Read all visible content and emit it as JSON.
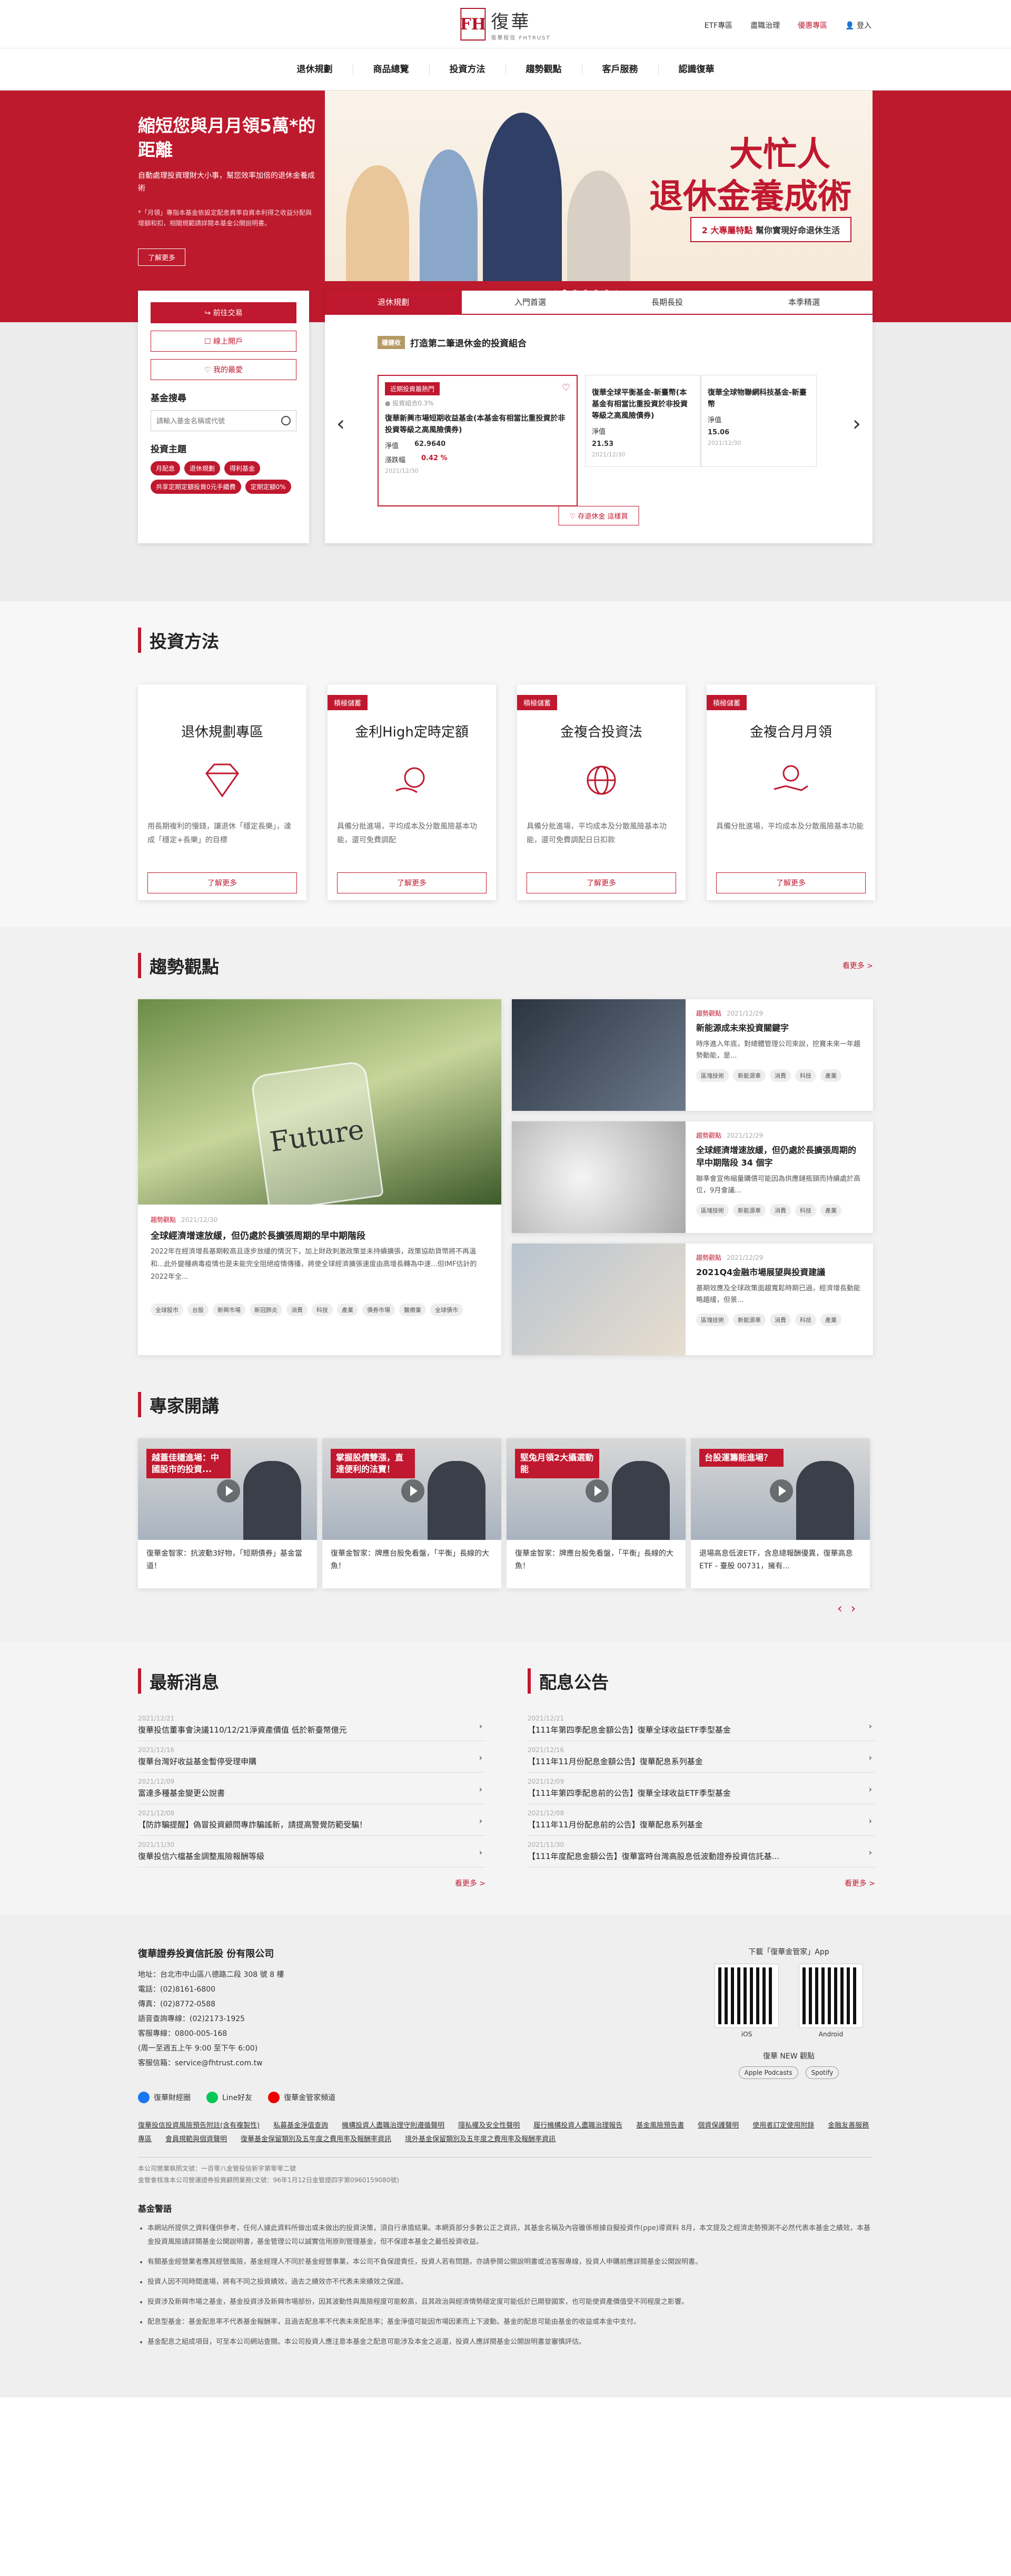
{
  "header": {
    "brand_cn": "復華",
    "brand_sub": "復華投信 FHTRUST",
    "links": [
      "ETF專區",
      "盡職治理",
      "優惠專區",
      "登入"
    ]
  },
  "nav": [
    "退休規劃",
    "商品總覽",
    "投資方法",
    "趨勢觀點",
    "客戶服務",
    "認識復華"
  ],
  "hero": {
    "title": "縮短您與月月領5萬*的距離",
    "desc": "自動處理投資理財大小事，幫您效率加倍的退休金養成術",
    "note": "*「月領」專指本基金依設定配息資率自資本利得之收益分配與增額和扣，相關規範請詳閱本基金公開說明書。",
    "button": "了解更多",
    "banner_l1": "大忙人",
    "banner_l2": "退休金養成術",
    "banner_tag_num": "2 大專屬特點",
    "banner_tag_text": " 幫你實現好命退休生活"
  },
  "side": {
    "buttons": [
      "前往交易",
      "線上開戶",
      "我的最愛"
    ],
    "search_title": "基金搜尋",
    "search_placeholder": "請輸入基金名稱或代號",
    "theme_title": "投資主題",
    "themes": [
      "月配息",
      "退休規劃",
      "得利基金",
      "共享定期定額投資0元手續費",
      "定期定額0%"
    ]
  },
  "fund": {
    "tabs": [
      "退休規劃",
      "入門首選",
      "長期長投",
      "本季精選"
    ],
    "badge": "穩健收",
    "headline": "打造第二筆退休金的投資組合",
    "main_card": {
      "hot": "近期投資最熱門",
      "meta": "● 投資組合0.3%",
      "name": "復華新興市場短期收益基金(本基金有相當比重投資於非投資等級之高風險債券)",
      "nav_label": "淨值",
      "nav_val": "62.9640",
      "chg_label": "漲跌幅",
      "chg_val": "0.42 %",
      "date": "2021/12/30"
    },
    "cards": [
      {
        "name": "復華全球平衡基金-新臺幣(本基金有相當比重投資於非投資等級之高風險債券)",
        "nav_label": "淨值",
        "nav_val": "21.53",
        "date": "2021/12/30"
      },
      {
        "name": "復華全球物聯網科技基金-新臺幣",
        "nav_label": "淨值",
        "nav_val": "15.06",
        "date": "2021/12/30"
      }
    ],
    "more": "♡ 存退休金 這樣買"
  },
  "strategy": {
    "title": "投資方法",
    "cards": [
      {
        "ribbon": "",
        "title": "退休規劃專區",
        "text": "用長期複利的慢錢，讓退休「穩定長樂」，達成「穩定+長樂」的目標",
        "btn": "了解更多"
      },
      {
        "ribbon": "積極儲蓄",
        "title": "金利High定時定額",
        "text": "具備分批進場，平均成本及分散風險基本功能，還可免費調配",
        "btn": "了解更多"
      },
      {
        "ribbon": "積極儲蓄",
        "title": "金複合投資法",
        "text": "具備分批進場，平均成本及分散風險基本功能，還可免費調配日日扣款",
        "btn": "了解更多"
      },
      {
        "ribbon": "積極儲蓄",
        "title": "金複合月月領",
        "text": "具備分批進場，平均成本及分散風險基本功能",
        "btn": "了解更多"
      }
    ]
  },
  "trend": {
    "title": "趨勢觀點",
    "more": "看更多 >",
    "big": {
      "jar": "Future",
      "cat": "趨勢觀點",
      "date": "2021/12/30",
      "title": "全球經濟增速放緩，但仍處於長擴張周期的早中期階段",
      "text": "2022年在經濟增長基期較高且逐步放緩的情況下，加上財政刺激政策並未持續擴張，政策協助貨幣將不再溫和...此外變種病毒疫情也是未能完全阻絕疫情傳播，將使全球經濟擴張速度由高增長轉為中速...但IMF估計的2022年全...",
      "chips": [
        "全球股市",
        "台股",
        "新興市場",
        "新冠肺炎",
        "消費",
        "科技",
        "產業",
        "債券市場",
        "醫療業",
        "全球債市"
      ]
    },
    "items": [
      {
        "cat": "趨勢觀點",
        "date": "2021/12/29",
        "title": "新能源成未來投資關鍵字",
        "text": "時序進入年底，對總體管理公司來說，挖寶未來一年趨勢動能，是...",
        "chips": [
          "區塊技術",
          "新能源車",
          "消費",
          "科技",
          "產業"
        ]
      },
      {
        "cat": "趨勢觀點",
        "date": "2021/12/29",
        "title": "全球經濟增速放緩，但仍處於長擴張周期的早中期階段 34 個字",
        "text": "聯準會宣佈縮量購債可能因為供應鏈瓶頸而持續處於高位，9月會議...",
        "chips": [
          "區塊技術",
          "新能源車",
          "消費",
          "科技",
          "產業"
        ]
      },
      {
        "cat": "趨勢觀點",
        "date": "2021/12/29",
        "title": "2021Q4金融市場展望與投資建議",
        "text": "基期效應及全球政策面趨寬鬆時期已過，經濟增長動能略趨緩，但景...",
        "chips": [
          "區塊技術",
          "新能源車",
          "消費",
          "科技",
          "產業"
        ]
      }
    ]
  },
  "experts": {
    "title": "專家開講",
    "videos": [
      {
        "cap": "越蓋佳穩進場：中國股市的投資...",
        "text": "復華金智家：抗波動3好物，「短期債券」基金當道！"
      },
      {
        "cap": "掌握股債雙漲，直達便利的法寶！",
        "text": "復華金智家：牌應台股免看盤，「平衡」長線的大魚！"
      },
      {
        "cap": "堅兔月領2大攝選動能",
        "text": "復華金智家：牌應台股免看盤，「平衡」長線的大魚！"
      },
      {
        "cap": "台股運籌能進場？",
        "text": "退場高息低波ETF，含息總報酬優異，復華高息ETF - 臺股 00731，擁有..."
      }
    ]
  },
  "news": {
    "title": "最新消息",
    "more": "看更多 >",
    "items": [
      {
        "d": "2021/12/21",
        "t": "復華投信董事會決議110/12/21淨資產價值 低於新臺幣億元"
      },
      {
        "d": "2021/12/16",
        "t": "復華台灣好收益基金暫停受理申購"
      },
      {
        "d": "2021/12/09",
        "t": "富達多種基金變更公說書"
      },
      {
        "d": "2021/12/08",
        "t": "【防詐騙提醒】偽冒投資顧問專詐騙謠新，請提高警覺防範受騙！"
      },
      {
        "d": "2021/11/30",
        "t": "復華投信六檔基金調整風險報酬等級"
      }
    ]
  },
  "notice": {
    "title": "配息公告",
    "more": "看更多 >",
    "items": [
      {
        "d": "2021/12/21",
        "t": "【111年第四季配息金額公告】復華全球收益ETF季型基金"
      },
      {
        "d": "2021/12/16",
        "t": "【111年11月份配息金額公告】復華配息系列基金"
      },
      {
        "d": "2021/12/09",
        "t": "【111年第四季配息前的公告】復華全球收益ETF季型基金"
      },
      {
        "d": "2021/12/08",
        "t": "【111年11月份配息前的公告】復華配息系列基金"
      },
      {
        "d": "2021/11/30",
        "t": "【111年度配息金額公告】復華富時台灣高股息低波動證券投資信託基..."
      }
    ]
  },
  "footer": {
    "company": "復華證券投資信託股 份有限公司",
    "info": [
      "地址：台北市中山區八德路二段 308 號 8 樓",
      "電話：(02)8161-6800",
      "傳真：(02)8772-0588",
      "語音查詢專線：(02)2173-1925",
      "客服專線：0800-005-168",
      "(周一至週五上午 9:00 至下午 6:00)",
      "客服信箱：service@fhtrust.com.tw"
    ],
    "app_title": "下載「復華金管家」App",
    "ios": "iOS",
    "android": "Android",
    "podcast": "復華 NEW 觀點",
    "pod_links": [
      "Apple Podcasts",
      "Spotify"
    ],
    "social": [
      "復華財經圈",
      "Line好友",
      "復華金管家頻道"
    ],
    "links": [
      "復華投信投資風險預告附註(含有複製性)",
      "私募基金淨值查詢",
      "機構投資人盡職治理守則遵循聲明",
      "隱私權及安全性聲明",
      "履行機構投資人盡職治理報告",
      "基金風險預告書",
      "個資保護聲明",
      "使用者訂定使用附錄",
      "金融友善服務專區",
      "會員規範與個資聲明",
      "復華基金保留類別及五年度之費用率及報酬率資訊",
      "境外基金保留類別及五年度之費用率及報酬率資訊"
    ],
    "small1": "本公司營業執照文號：一百零八金管投信新字第零零二號",
    "small2": "金管會核准本公司營運證券投資顧問業務(文號：96年1月12日金管證四字第0960159080號)",
    "warn_title": "基金警語",
    "warns": [
      "本網站所提供之資料僅供參考，任何人據此資料所做出或未做出的投資決策，須自行承擔結果。本網頁部分多數公正之資訊，其基金名稱及內容雖係根據自擬投資作(ppe)導資料 8月，本文提及之經濟走勢預測不必然代表本基金之績效，本基金投資風險請詳閱基金公開說明書，基金管理公司以誠實信用原則管理基金，但不保證本基金之最低投資收益。",
      "有關基金經營業者應其經營風險，基金經理人不同於基金經營事業，本公司不負保證責任，投資人若有問題，亦請參閱公開說明書或洽客服專線，投資人申購前應詳閱基金公開說明書。",
      "投資人因不同時間進場，將有不同之投資績效，過去之績效亦不代表未來績效之保證。",
      "投資涉及新興市場之基金，基金投資涉及新興市場部份，因其波動性與風險程度可能較高，且其政治與經濟情勢穩定度可能低於已開發國家，也可能使資產價值受不同程度之影響。",
      "配息型基金：基金配息率不代表基金報酬率，且過去配息率不代表未來配息率；基金淨值可能因市場因素而上下波動。基金的配息可能由基金的收益或本金中支付。",
      "基金配息之組成項目，可至本公司網站查閱。本公司投資人應注意本基金之配息可能涉及本金之返還，投資人應詳閱基金公開說明書並審慎評估。"
    ]
  }
}
